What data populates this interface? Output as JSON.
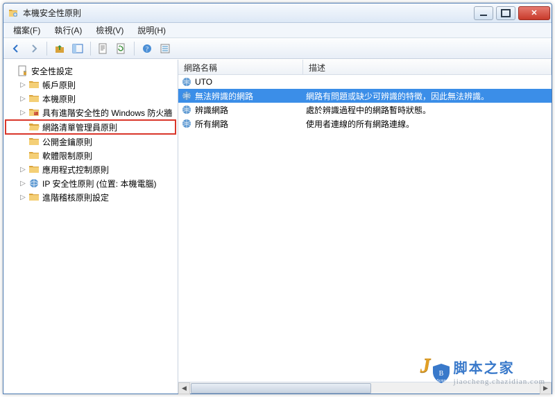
{
  "window": {
    "title": "本機安全性原則"
  },
  "menu": {
    "file": "檔案(F)",
    "action": "執行(A)",
    "view": "檢視(V)",
    "help": "說明(H)"
  },
  "tree": {
    "root": "安全性設定",
    "items": [
      "帳戶原則",
      "本機原則",
      "具有進階安全性的 Windows 防火牆",
      "網路清單管理員原則",
      "公開金鑰原則",
      "軟體限制原則",
      "應用程式控制原則",
      "IP 安全性原則 (位置: 本機電腦)",
      "進階稽核原則設定"
    ],
    "highlight_index": 3
  },
  "list": {
    "columns": {
      "name": "網路名稱",
      "desc": "描述"
    },
    "rows": [
      {
        "name": "UTO",
        "desc": ""
      },
      {
        "name": "無法辨識的網路",
        "desc": "網路有問題或缺少可辨識的特徵，因此無法辨識。"
      },
      {
        "name": "辨識網路",
        "desc": "處於辨識過程中的網路暫時狀態。"
      },
      {
        "name": "所有網路",
        "desc": "使用者連線的所有網路連線。"
      }
    ],
    "selected_index": 1
  },
  "watermark": {
    "cn": "脚本之家",
    "en": "jiaocheng.chazidian.com",
    "script_label": "Script"
  }
}
